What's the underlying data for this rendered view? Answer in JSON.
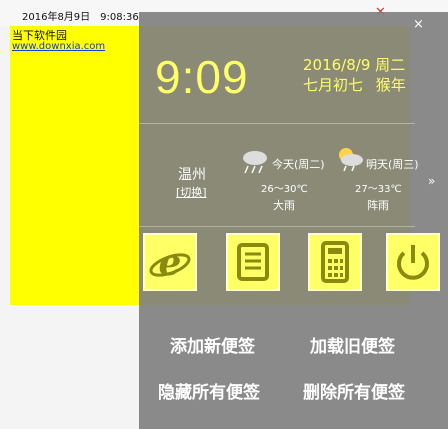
{
  "note": {
    "datetime": "2016年8月9日　9:08:36",
    "line1": "当下软件园",
    "line2": "www.downxia.com"
  },
  "panel": {
    "time": "9:09",
    "date": "2016/8/9",
    "weekday": "周二",
    "lunar": "七月初七",
    "zodiac": "猴年",
    "city": "温州",
    "switch": "[切换]",
    "today": {
      "label": "今天(周二)",
      "temp": "26～30℃",
      "desc": "大雨"
    },
    "tomorrow": {
      "label": "明天(周三)",
      "temp": "27～33℃",
      "desc": "阵雨"
    },
    "more": "»",
    "close": "×",
    "actions": {
      "add": "添加新便签",
      "load": "加载旧便签",
      "hide": "隐藏所有便签",
      "delete": "删除所有便签"
    }
  },
  "icons": [
    "ie-icon",
    "notepad-icon",
    "calculator-icon",
    "power-icon"
  ],
  "colors": {
    "note_bg": "#ffff00",
    "accent_yellow": "#ffff66",
    "panel": "#808080"
  }
}
